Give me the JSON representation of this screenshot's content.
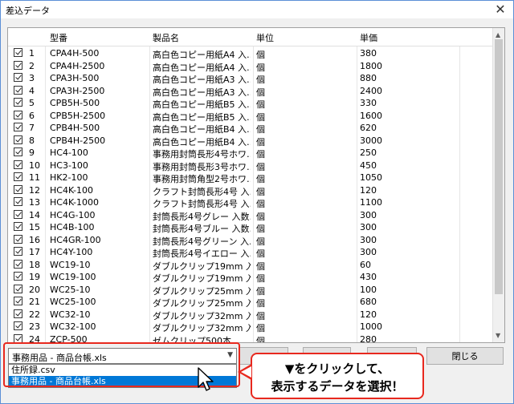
{
  "window": {
    "title": "差込データ",
    "close_glyph": "✕"
  },
  "grid": {
    "headers": [
      "",
      "型番",
      "製品名",
      "単位",
      "単価"
    ],
    "rows": [
      {
        "no": "1",
        "code": "CPA4H-500",
        "name": "高白色コピー用紙A4 入…",
        "unit": "個",
        "price": "380"
      },
      {
        "no": "2",
        "code": "CPA4H-2500",
        "name": "高白色コピー用紙A4 入…",
        "unit": "個",
        "price": "1800"
      },
      {
        "no": "3",
        "code": "CPA3H-500",
        "name": "高白色コピー用紙A3 入…",
        "unit": "個",
        "price": "880"
      },
      {
        "no": "4",
        "code": "CPA3H-2500",
        "name": "高白色コピー用紙A3 入…",
        "unit": "個",
        "price": "2400"
      },
      {
        "no": "5",
        "code": "CPB5H-500",
        "name": "高白色コピー用紙B5 入…",
        "unit": "個",
        "price": "330"
      },
      {
        "no": "6",
        "code": "CPB5H-2500",
        "name": "高白色コピー用紙B5 入…",
        "unit": "個",
        "price": "1600"
      },
      {
        "no": "7",
        "code": "CPB4H-500",
        "name": "高白色コピー用紙B4 入…",
        "unit": "個",
        "price": "620"
      },
      {
        "no": "8",
        "code": "CPB4H-2500",
        "name": "高白色コピー用紙B4 入…",
        "unit": "個",
        "price": "3000"
      },
      {
        "no": "9",
        "code": "HC4-100",
        "name": "事務用封筒長形4号ホワ…",
        "unit": "個",
        "price": "250"
      },
      {
        "no": "10",
        "code": "HC3-100",
        "name": "事務用封筒長形3号ホワ…",
        "unit": "個",
        "price": "450"
      },
      {
        "no": "11",
        "code": "HK2-100",
        "name": "事務用封筒角型2号ホワ…",
        "unit": "個",
        "price": "1050"
      },
      {
        "no": "12",
        "code": "HC4K-100",
        "name": "クラフト封筒長形4号 入…",
        "unit": "個",
        "price": "120"
      },
      {
        "no": "13",
        "code": "HC4K-1000",
        "name": "クラフト封筒長形4号 入…",
        "unit": "個",
        "price": "1100"
      },
      {
        "no": "14",
        "code": "HC4G-100",
        "name": "封筒長形4号グレー 入数…",
        "unit": "個",
        "price": "300"
      },
      {
        "no": "15",
        "code": "HC4B-100",
        "name": "封筒長形4号ブルー 入数…",
        "unit": "個",
        "price": "300"
      },
      {
        "no": "16",
        "code": "HC4GR-100",
        "name": "封筒長形4号グリーン 入…",
        "unit": "個",
        "price": "300"
      },
      {
        "no": "17",
        "code": "HC4Y-100",
        "name": "封筒長形4号イエロー 入…",
        "unit": "個",
        "price": "300"
      },
      {
        "no": "18",
        "code": "WC19-10",
        "name": "ダブルクリップ19mm 入数…",
        "unit": "個",
        "price": "60"
      },
      {
        "no": "19",
        "code": "WC19-100",
        "name": "ダブルクリップ19mm 入数…",
        "unit": "個",
        "price": "430"
      },
      {
        "no": "20",
        "code": "WC25-10",
        "name": "ダブルクリップ25mm 入数…",
        "unit": "個",
        "price": "100"
      },
      {
        "no": "21",
        "code": "WC25-100",
        "name": "ダブルクリップ25mm 入数…",
        "unit": "個",
        "price": "680"
      },
      {
        "no": "22",
        "code": "WC32-10",
        "name": "ダブルクリップ32mm 入数…",
        "unit": "個",
        "price": "120"
      },
      {
        "no": "23",
        "code": "WC32-100",
        "name": "ダブルクリップ32mm 入数…",
        "unit": "個",
        "price": "1000"
      },
      {
        "no": "24",
        "code": "ZCP-500",
        "name": "ゼムクリップ500本",
        "unit": "個",
        "price": "280"
      }
    ]
  },
  "source_select": {
    "value": "事務用品 - 商品台帳.xls",
    "options": [
      "住所録.csv",
      "事務用品 - 商品台帳.xls"
    ],
    "selected_index": 1
  },
  "buttons": {
    "close": "閉じる"
  },
  "callout": {
    "line1": "▼をクリックして、",
    "line2": "表示するデータを選択！"
  },
  "colors": {
    "highlight": "#e8281e",
    "selection": "#0078d7",
    "window_border": "#5c8fd6"
  }
}
